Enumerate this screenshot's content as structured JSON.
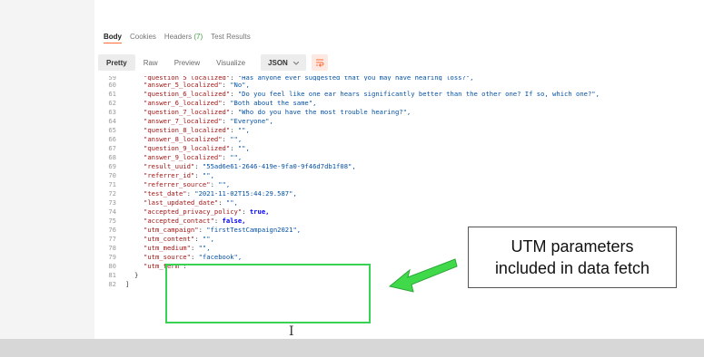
{
  "response_tabs": {
    "body": "Body",
    "cookies": "Cookies",
    "headers": "Headers",
    "headers_count": "(7)",
    "test_results": "Test Results"
  },
  "view_bar": {
    "pretty": "Pretty",
    "raw": "Raw",
    "preview": "Preview",
    "visualize": "Visualize",
    "format": "JSON",
    "wrap_icon": "wrap-lines-icon"
  },
  "code_lines": [
    {
      "n": "59",
      "key": "\"question_5_localized\"",
      "val": "\"Has anyone ever suggested that you may have hearing loss?\","
    },
    {
      "n": "60",
      "key": "\"answer_5_localized\"",
      "val": "\"No\","
    },
    {
      "n": "61",
      "key": "\"question_6_localized\"",
      "val": "\"Do you feel like one ear hears significantly better than the other one? If so, which one?\","
    },
    {
      "n": "62",
      "key": "\"answer_6_localized\"",
      "val": "\"Both about the same\","
    },
    {
      "n": "63",
      "key": "\"question_7_localized\"",
      "val": "\"Who do you have the most trouble hearing?\","
    },
    {
      "n": "64",
      "key": "\"answer_7_localized\"",
      "val": "\"Everyone\","
    },
    {
      "n": "65",
      "key": "\"question_8_localized\"",
      "val": "\"\","
    },
    {
      "n": "66",
      "key": "\"answer_8_localized\"",
      "val": "\"\","
    },
    {
      "n": "67",
      "key": "\"question_9_localized\"",
      "val": "\"\","
    },
    {
      "n": "68",
      "key": "\"answer_9_localized\"",
      "val": "\"\","
    },
    {
      "n": "69",
      "key": "\"result_uuid\"",
      "val": "\"55ad6e61-2646-419e-9fa0-9f46d7db1f08\","
    },
    {
      "n": "70",
      "key": "\"referrer_id\"",
      "val": "\"\","
    },
    {
      "n": "71",
      "key": "\"referrer_source\"",
      "val": "\"\","
    },
    {
      "n": "72",
      "key": "\"test_date\"",
      "val": "\"2021-11-02T15:44:29.587\","
    },
    {
      "n": "73",
      "key": "\"last_updated_date\"",
      "val": "\"\","
    },
    {
      "n": "74",
      "key": "\"accepted_privacy_policy\"",
      "val": "true,",
      "bool": true
    },
    {
      "n": "75",
      "key": "\"accepted_contact\"",
      "val": "false,",
      "bool": true
    },
    {
      "n": "76",
      "key": "\"utm_campaign\"",
      "val": "\"firstTestCampaign2021\","
    },
    {
      "n": "77",
      "key": "\"utm_content\"",
      "val": "\"\","
    },
    {
      "n": "78",
      "key": "\"utm_medium\"",
      "val": "\"\","
    },
    {
      "n": "79",
      "key": "\"utm_source\"",
      "val": "\"facebook\","
    },
    {
      "n": "80",
      "key": "\"utm_term\"",
      "val": "\"\""
    },
    {
      "n": "81",
      "key": "",
      "val": "}",
      "brace": true
    },
    {
      "n": "82",
      "key": "",
      "val": "]",
      "brace": true
    }
  ],
  "callout": {
    "line1": "UTM parameters",
    "line2": "included in data fetch"
  },
  "colors": {
    "highlight_green": "#39d353",
    "arrow_green": "#3fd94a",
    "accent_orange": "#ff6c37"
  }
}
